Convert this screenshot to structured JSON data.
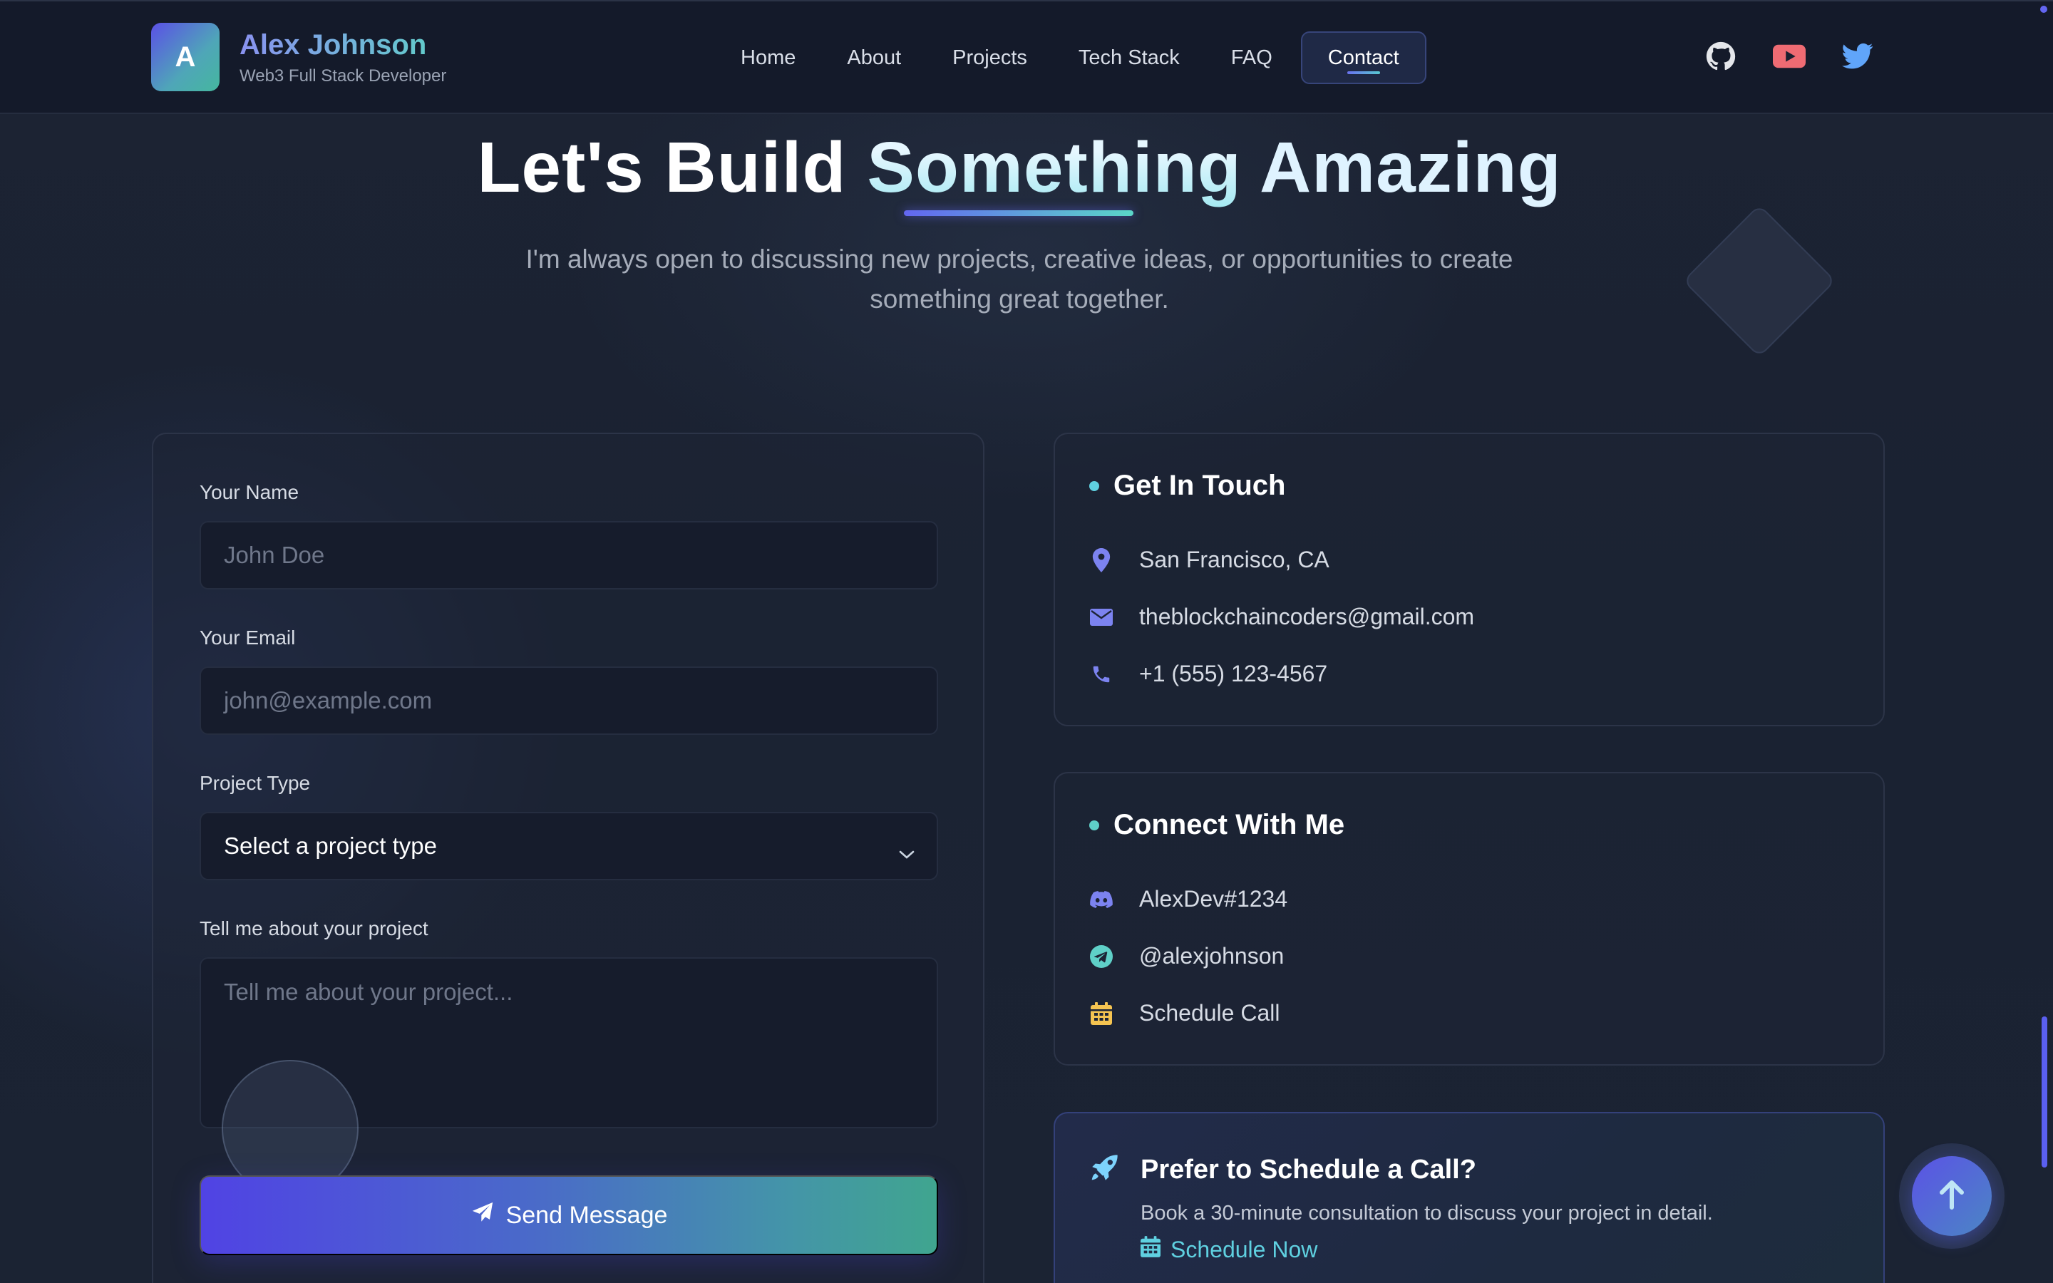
{
  "brand": {
    "initial": "A",
    "name": "Alex Johnson",
    "subtitle": "Web3 Full Stack Developer"
  },
  "nav": {
    "items": [
      {
        "label": "Home"
      },
      {
        "label": "About"
      },
      {
        "label": "Projects"
      },
      {
        "label": "Tech Stack"
      },
      {
        "label": "FAQ"
      },
      {
        "label": "Contact",
        "active": true
      }
    ]
  },
  "socials": {
    "icons": [
      "github-icon",
      "youtube-icon",
      "twitter-icon"
    ],
    "youtube_color": "#ef6b73",
    "twitter_color": "#60a5fa"
  },
  "hero": {
    "title_part1": "Let's Build ",
    "title_highlight": "Something",
    "title_part2": " Amazing",
    "subtitle": "I'm always open to discussing new projects, creative ideas, or opportunities to create something great together."
  },
  "form": {
    "name_label": "Your Name",
    "name_placeholder": "John Doe",
    "email_label": "Your Email",
    "email_placeholder": "john@example.com",
    "project_type_label": "Project Type",
    "project_type_value": "Select a project type",
    "message_label": "Tell me about your project",
    "message_placeholder": "Tell me about your project...",
    "submit_label": "Send Message"
  },
  "get_in_touch": {
    "title": "Get In Touch",
    "location": "San Francisco, CA",
    "email": "theblockchaincoders@gmail.com",
    "phone": "+1 (555) 123-4567"
  },
  "connect": {
    "title": "Connect With Me",
    "discord": "AlexDev#1234",
    "telegram": "@alexjohnson",
    "schedule": "Schedule Call"
  },
  "promo": {
    "title": "Prefer to Schedule a Call?",
    "subtitle": "Book a 30-minute consultation to discuss your project in detail.",
    "link": "Schedule Now"
  },
  "colors": {
    "accent": "#6366f1",
    "teal": "#5fd0c8",
    "background": "#1a2030"
  }
}
